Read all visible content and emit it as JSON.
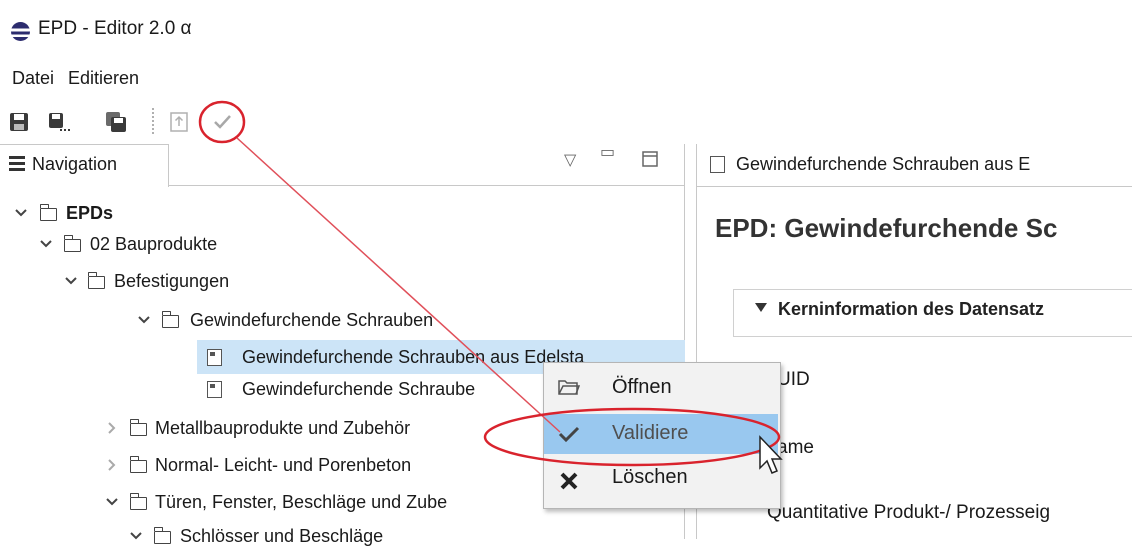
{
  "window": {
    "title": "EPD - Editor 2.0 α"
  },
  "menu": {
    "items": [
      "Datei",
      "Editieren"
    ]
  },
  "toolbar": {
    "buttons": [
      "save-icon",
      "save-as-icon",
      "save-all-icon",
      "export-icon",
      "validate-icon"
    ]
  },
  "navigation": {
    "tab_label": "Navigation",
    "tree": [
      {
        "label": "EPDs",
        "bold": true,
        "expanded": true
      },
      {
        "label": "02 Bauprodukte",
        "expanded": true
      },
      {
        "label": "Befestigungen",
        "expanded": true
      },
      {
        "label": "Gewindefurchende Schrauben",
        "expanded": true
      },
      {
        "label": "Gewindefurchende Schrauben aus Edelsta",
        "selected": true
      },
      {
        "label": "Gewindefurchende Schraube"
      },
      {
        "label": "Metallbauprodukte und Zubehör",
        "expanded": false
      },
      {
        "label": "Normal- Leicht- und Porenbeton",
        "expanded": false
      },
      {
        "label": "Türen, Fenster, Beschläge und Zube",
        "expanded": true
      },
      {
        "label": "Schlösser und Beschläge",
        "expanded": true
      }
    ]
  },
  "editor": {
    "tab_label": "Gewindefurchende Schrauben aus E",
    "heading": "EPD: Gewindefurchende Sc",
    "section_title": "Kerninformation des Datensatz",
    "fields": [
      "UID",
      "ame",
      "Quantitative Produkt-/ Prozesseig"
    ]
  },
  "context_menu": {
    "items": [
      {
        "label": "Öffnen",
        "icon": "folder-open-icon"
      },
      {
        "label": "Validiere",
        "icon": "check-icon",
        "highlighted": true
      },
      {
        "label": "Löschen",
        "icon": "delete-x-icon"
      }
    ]
  },
  "colors": {
    "selection": "#cce4f7",
    "menu_hover": "#99c8ef",
    "annotation": "#d9232d"
  }
}
